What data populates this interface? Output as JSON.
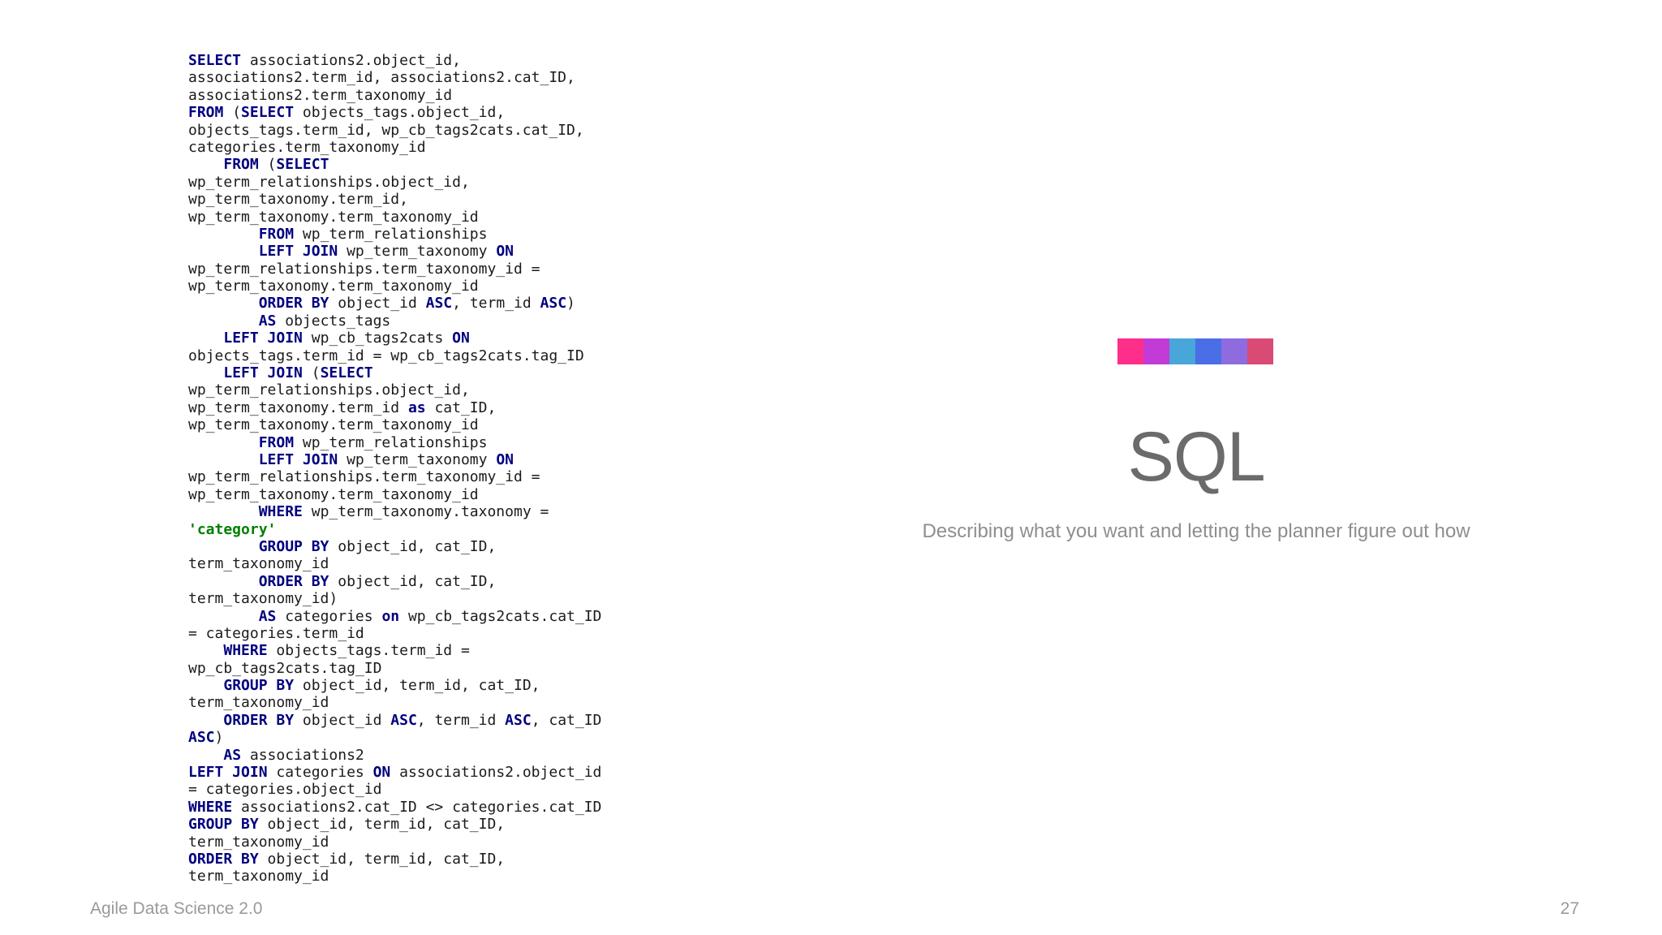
{
  "slide": {
    "title": "SQL",
    "subtitle": "Describing what you want and letting the planner figure out how",
    "footer_left": "Agile Data Science 2.0",
    "page_number": "27"
  },
  "color_bar": [
    "#ff2e8a",
    "#c33bd6",
    "#48a6d8",
    "#4a6ee6",
    "#8e6ce0",
    "#d94a74"
  ],
  "code_lines": [
    [
      {
        "t": "SELECT",
        "k": "kw"
      },
      {
        "t": " associations2.object_id,"
      }
    ],
    [
      {
        "t": "associations2.term_id, associations2.cat_ID,"
      }
    ],
    [
      {
        "t": "associations2.term_taxonomy_id"
      }
    ],
    [
      {
        "t": "FROM",
        "k": "kw"
      },
      {
        "t": " ("
      },
      {
        "t": "SELECT",
        "k": "kw"
      },
      {
        "t": " objects_tags.object_id,"
      }
    ],
    [
      {
        "t": "objects_tags.term_id, wp_cb_tags2cats.cat_ID,"
      }
    ],
    [
      {
        "t": "categories.term_taxonomy_id"
      }
    ],
    [
      {
        "t": "    "
      },
      {
        "t": "FROM",
        "k": "kw"
      },
      {
        "t": " ("
      },
      {
        "t": "SELECT",
        "k": "kw"
      }
    ],
    [
      {
        "t": "wp_term_relationships.object_id,"
      }
    ],
    [
      {
        "t": "wp_term_taxonomy.term_id,"
      }
    ],
    [
      {
        "t": "wp_term_taxonomy.term_taxonomy_id"
      }
    ],
    [
      {
        "t": "        "
      },
      {
        "t": "FROM",
        "k": "kw"
      },
      {
        "t": " wp_term_relationships"
      }
    ],
    [
      {
        "t": "        "
      },
      {
        "t": "LEFT JOIN",
        "k": "kw"
      },
      {
        "t": " wp_term_taxonomy "
      },
      {
        "t": "ON",
        "k": "kw"
      }
    ],
    [
      {
        "t": "wp_term_relationships.term_taxonomy_id ="
      }
    ],
    [
      {
        "t": "wp_term_taxonomy.term_taxonomy_id"
      }
    ],
    [
      {
        "t": "        "
      },
      {
        "t": "ORDER BY",
        "k": "kw"
      },
      {
        "t": " object_id "
      },
      {
        "t": "ASC",
        "k": "kw"
      },
      {
        "t": ", term_id "
      },
      {
        "t": "ASC",
        "k": "kw"
      },
      {
        "t": ")"
      }
    ],
    [
      {
        "t": "        "
      },
      {
        "t": "AS",
        "k": "kw"
      },
      {
        "t": " objects_tags"
      }
    ],
    [
      {
        "t": "    "
      },
      {
        "t": "LEFT JOIN",
        "k": "kw"
      },
      {
        "t": " wp_cb_tags2cats "
      },
      {
        "t": "ON",
        "k": "kw"
      }
    ],
    [
      {
        "t": "objects_tags.term_id = wp_cb_tags2cats.tag_ID"
      }
    ],
    [
      {
        "t": "    "
      },
      {
        "t": "LEFT JOIN",
        "k": "kw"
      },
      {
        "t": " ("
      },
      {
        "t": "SELECT",
        "k": "kw"
      }
    ],
    [
      {
        "t": "wp_term_relationships.object_id,"
      }
    ],
    [
      {
        "t": "wp_term_taxonomy.term_id "
      },
      {
        "t": "as",
        "k": "kw"
      },
      {
        "t": " cat_ID,"
      }
    ],
    [
      {
        "t": "wp_term_taxonomy.term_taxonomy_id"
      }
    ],
    [
      {
        "t": "        "
      },
      {
        "t": "FROM",
        "k": "kw"
      },
      {
        "t": " wp_term_relationships"
      }
    ],
    [
      {
        "t": "        "
      },
      {
        "t": "LEFT JOIN",
        "k": "kw"
      },
      {
        "t": " wp_term_taxonomy "
      },
      {
        "t": "ON",
        "k": "kw"
      }
    ],
    [
      {
        "t": "wp_term_relationships.term_taxonomy_id ="
      }
    ],
    [
      {
        "t": "wp_term_taxonomy.term_taxonomy_id"
      }
    ],
    [
      {
        "t": "        "
      },
      {
        "t": "WHERE",
        "k": "kw"
      },
      {
        "t": " wp_term_taxonomy.taxonomy ="
      }
    ],
    [
      {
        "t": "'category'",
        "k": "str"
      }
    ],
    [
      {
        "t": "        "
      },
      {
        "t": "GROUP BY",
        "k": "kw"
      },
      {
        "t": " object_id, cat_ID,"
      }
    ],
    [
      {
        "t": "term_taxonomy_id"
      }
    ],
    [
      {
        "t": "        "
      },
      {
        "t": "ORDER BY",
        "k": "kw"
      },
      {
        "t": " object_id, cat_ID,"
      }
    ],
    [
      {
        "t": "term_taxonomy_id)"
      }
    ],
    [
      {
        "t": "        "
      },
      {
        "t": "AS",
        "k": "kw"
      },
      {
        "t": " categories "
      },
      {
        "t": "on",
        "k": "kw"
      },
      {
        "t": " wp_cb_tags2cats.cat_ID"
      }
    ],
    [
      {
        "t": "= categories.term_id"
      }
    ],
    [
      {
        "t": "    "
      },
      {
        "t": "WHERE",
        "k": "kw"
      },
      {
        "t": " objects_tags.term_id ="
      }
    ],
    [
      {
        "t": "wp_cb_tags2cats.tag_ID"
      }
    ],
    [
      {
        "t": "    "
      },
      {
        "t": "GROUP BY",
        "k": "kw"
      },
      {
        "t": " object_id, term_id, cat_ID,"
      }
    ],
    [
      {
        "t": "term_taxonomy_id"
      }
    ],
    [
      {
        "t": "    "
      },
      {
        "t": "ORDER BY",
        "k": "kw"
      },
      {
        "t": " object_id "
      },
      {
        "t": "ASC",
        "k": "kw"
      },
      {
        "t": ", term_id "
      },
      {
        "t": "ASC",
        "k": "kw"
      },
      {
        "t": ", cat_ID"
      }
    ],
    [
      {
        "t": "ASC",
        "k": "kw"
      },
      {
        "t": ")"
      }
    ],
    [
      {
        "t": "    "
      },
      {
        "t": "AS",
        "k": "kw"
      },
      {
        "t": " associations2"
      }
    ],
    [
      {
        "t": "LEFT JOIN",
        "k": "kw"
      },
      {
        "t": " categories "
      },
      {
        "t": "ON",
        "k": "kw"
      },
      {
        "t": " associations2.object_id"
      }
    ],
    [
      {
        "t": "= categories.object_id"
      }
    ],
    [
      {
        "t": "WHERE",
        "k": "kw"
      },
      {
        "t": " associations2.cat_ID <> categories.cat_ID"
      }
    ],
    [
      {
        "t": "GROUP BY",
        "k": "kw"
      },
      {
        "t": " object_id, term_id, cat_ID,"
      }
    ],
    [
      {
        "t": "term_taxonomy_id"
      }
    ],
    [
      {
        "t": "ORDER BY",
        "k": "kw"
      },
      {
        "t": " object_id, term_id, cat_ID,"
      }
    ],
    [
      {
        "t": "term_taxonomy_id"
      }
    ]
  ]
}
